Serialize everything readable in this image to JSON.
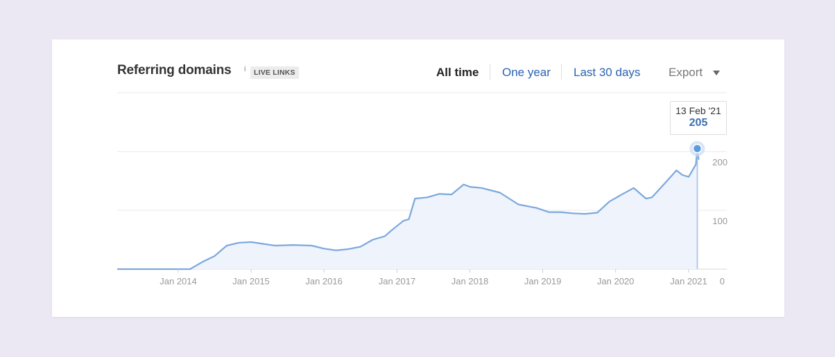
{
  "header": {
    "title": "Referring domains",
    "info": "i",
    "badge": "LIVE LINKS"
  },
  "tabs": {
    "all_time": "All time",
    "one_year": "One year",
    "last_30_days": "Last 30 days",
    "export": "Export"
  },
  "tooltip": {
    "date": "13 Feb '21",
    "value": "205"
  },
  "colors": {
    "line": "#7ba7dc",
    "fill": "#eef3fc",
    "link": "#2a62b3",
    "marker": "#5c9bdf"
  },
  "chart_data": {
    "type": "area",
    "x_tick_labels": [
      "Jan 2014",
      "Jan 2015",
      "Jan 2016",
      "Jan 2017",
      "Jan 2018",
      "Jan 2019",
      "Jan 2020",
      "Jan 2021"
    ],
    "y_ticks": [
      0,
      100,
      200
    ],
    "ylim": [
      0,
      300
    ],
    "grid": true,
    "series": [
      {
        "values": [
          [
            "2013-02-01",
            0
          ],
          [
            "2014-03-01",
            0
          ],
          [
            "2014-05-01",
            12
          ],
          [
            "2014-07-01",
            22
          ],
          [
            "2014-09-01",
            40
          ],
          [
            "2014-11-01",
            45
          ],
          [
            "2015-01-01",
            46
          ],
          [
            "2015-03-01",
            43
          ],
          [
            "2015-05-01",
            40
          ],
          [
            "2015-08-01",
            41
          ],
          [
            "2015-11-01",
            40
          ],
          [
            "2016-01-01",
            35
          ],
          [
            "2016-03-01",
            32
          ],
          [
            "2016-05-01",
            34
          ],
          [
            "2016-07-01",
            38
          ],
          [
            "2016-09-01",
            50
          ],
          [
            "2016-11-01",
            56
          ],
          [
            "2016-12-01",
            65
          ],
          [
            "2017-02-01",
            82
          ],
          [
            "2017-03-01",
            85
          ],
          [
            "2017-04-01",
            120
          ],
          [
            "2017-06-01",
            122
          ],
          [
            "2017-08-01",
            128
          ],
          [
            "2017-10-01",
            127
          ],
          [
            "2017-12-01",
            144
          ],
          [
            "2018-01-01",
            140
          ],
          [
            "2018-03-01",
            138
          ],
          [
            "2018-06-01",
            130
          ],
          [
            "2018-09-01",
            110
          ],
          [
            "2018-12-01",
            104
          ],
          [
            "2019-02-01",
            97
          ],
          [
            "2019-04-01",
            97
          ],
          [
            "2019-06-01",
            95
          ],
          [
            "2019-08-01",
            94
          ],
          [
            "2019-10-01",
            96
          ],
          [
            "2019-12-01",
            115
          ],
          [
            "2020-02-01",
            127
          ],
          [
            "2020-04-01",
            138
          ],
          [
            "2020-06-01",
            120
          ],
          [
            "2020-07-01",
            122
          ],
          [
            "2020-09-01",
            145
          ],
          [
            "2020-11-01",
            168
          ],
          [
            "2020-12-01",
            160
          ],
          [
            "2021-01-01",
            157
          ],
          [
            "2021-02-06",
            178
          ],
          [
            "2021-02-13",
            205
          ],
          [
            "2021-02-20",
            186
          ]
        ]
      }
    ],
    "highlight": {
      "x": "2021-02-13",
      "y": 205
    }
  }
}
